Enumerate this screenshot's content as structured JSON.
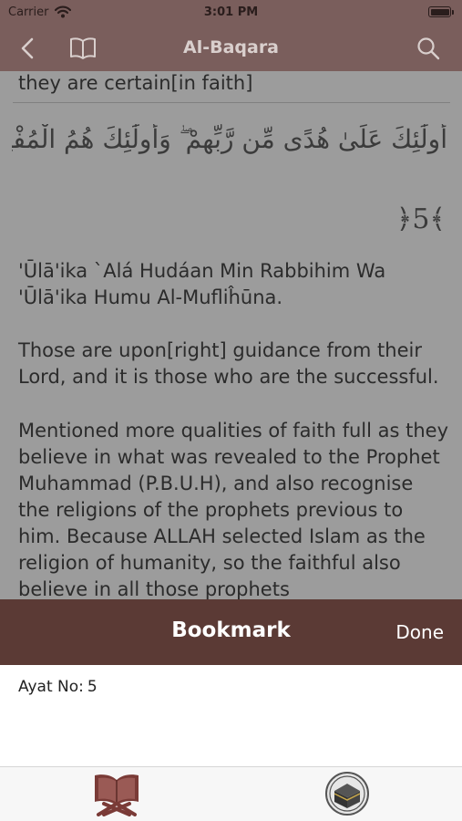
{
  "status_bar": {
    "carrier": "Carrier",
    "time": "3:01 PM"
  },
  "nav": {
    "title": "Al-Baqara",
    "icons": [
      "back-chevron-icon",
      "book-icon",
      "search-icon"
    ]
  },
  "content": {
    "previous_line": "they are certain[in faith]",
    "arabic": "أُولَٰئِكَ عَلَىٰ هُدًى مِّن رَّبِّهِمْ ۖ وَأُولَٰئِكَ هُمُ الْمُفْلِحُونَ",
    "ayah_marker": "﴿5﴾",
    "transliteration": "'Ūlā'ika `Alá Hudáan Min Rabbihim Wa 'Ūlā'ika Humu Al-Mufliĥūna.",
    "translation": "Those are upon[right] guidance from their Lord, and it is those who are the successful.",
    "tafsir": "Mentioned more qualities of faith full as they believe in what was revealed to the Prophet Muhammad (P.B.U.H), and also recognise the religions of the prophets previous to him. Because ALLAH selected Islam as the religion of humanity, so the faithful also believe in all those prophets"
  },
  "bookmark_sheet": {
    "title": "Bookmark",
    "done_label": "Done",
    "ayat_label": "Ayat No:",
    "ayat_value": "5"
  },
  "tab_bar": {
    "items": [
      "quran-book-icon",
      "kaaba-icon"
    ]
  },
  "colors": {
    "nav_brown": "#7a5e5c",
    "sheet_brown": "#5b3a35",
    "dim_overlay": "#9c9c9c"
  }
}
